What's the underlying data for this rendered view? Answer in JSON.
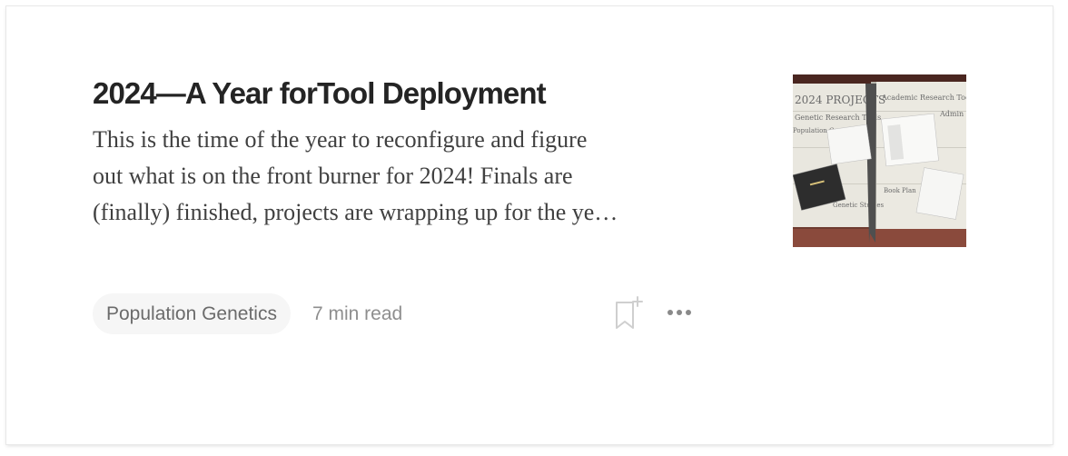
{
  "article": {
    "title": "2024—A Year forTool Deployment",
    "excerpt_lines": [
      "This is the time of the year to reconfigure and figure",
      "out what is on the front burner for 2024! Finals are",
      "(finally) finished, projects are wrapping up for the ye…"
    ],
    "tag": "Population Genetics",
    "read_time": "7 min read"
  },
  "thumbnail": {
    "notebook_texts": [
      "2024 PROJECTS",
      "Academic Research Tools",
      "Genetic Research Tools",
      "Admin",
      "Population Graphs",
      "Book Plan",
      "Genetic Studies"
    ]
  },
  "actions": {
    "save_icon": "bookmark-plus-icon",
    "more_icon": "more-horizontal-icon"
  },
  "colors": {
    "title": "#242424",
    "excerpt": "#404040",
    "tag_bg": "#f6f6f6",
    "muted": "#8e8e8e"
  }
}
